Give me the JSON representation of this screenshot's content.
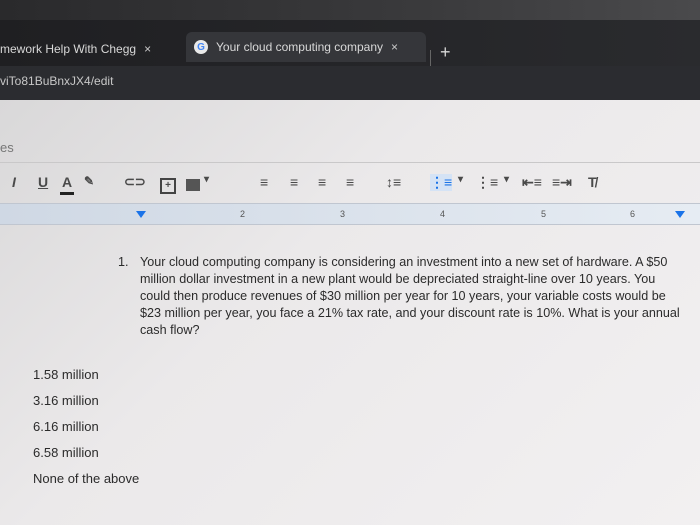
{
  "browser": {
    "tabs": [
      {
        "title": "mework Help With Chegg",
        "close": "×"
      },
      {
        "title": "Your cloud computing company",
        "close": "×"
      }
    ],
    "new_tab": "+",
    "url": "viTo81BuBnxJX4/edit"
  },
  "docs": {
    "menu_hint": "es",
    "ruler_numbers": [
      "2",
      "3",
      "4",
      "5",
      "6"
    ]
  },
  "question": {
    "number": "1.",
    "text": "Your cloud computing company is considering an investment into a new set of hardware. A $50 million dollar investment in a new plant would be depreciated straight-line over 10 years. You could then produce revenues of $30 million per year for 10 years, your variable costs would be $23 million per year, you face a 21% tax rate, and your discount rate is 10%. What is your annual cash flow?"
  },
  "options": [
    "1.58 million",
    "3.16 million",
    "6.16 million",
    "6.58 million",
    "None of the above"
  ]
}
